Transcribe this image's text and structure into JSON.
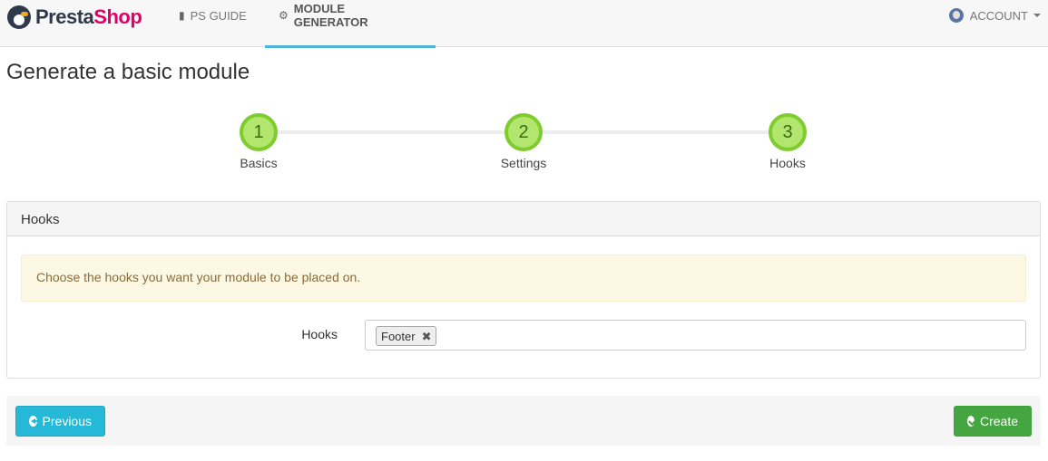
{
  "brand": {
    "part1": "Presta",
    "part2": "Shop"
  },
  "nav": {
    "items": [
      {
        "label": "PS GUIDE",
        "icon": "book-icon"
      },
      {
        "label": "MODULE GENERATOR",
        "icon": "cogs-icon",
        "active": true
      }
    ],
    "account_label": "ACCOUNT"
  },
  "page": {
    "title": "Generate a basic module"
  },
  "stepper": {
    "steps": [
      {
        "number": "1",
        "label": "Basics"
      },
      {
        "number": "2",
        "label": "Settings"
      },
      {
        "number": "3",
        "label": "Hooks"
      }
    ],
    "active_color": "#7fcc2f"
  },
  "panel": {
    "heading": "Hooks",
    "alert": "Choose the hooks you want your module to be placed on.",
    "field_label": "Hooks",
    "selected_tags": [
      "Footer"
    ],
    "remove_symbol": "✖"
  },
  "footer": {
    "previous_label": "Previous",
    "create_label": "Create"
  },
  "colors": {
    "primary": "#25b9d7",
    "success": "#45a641",
    "warning_bg": "#fcf8e3"
  }
}
